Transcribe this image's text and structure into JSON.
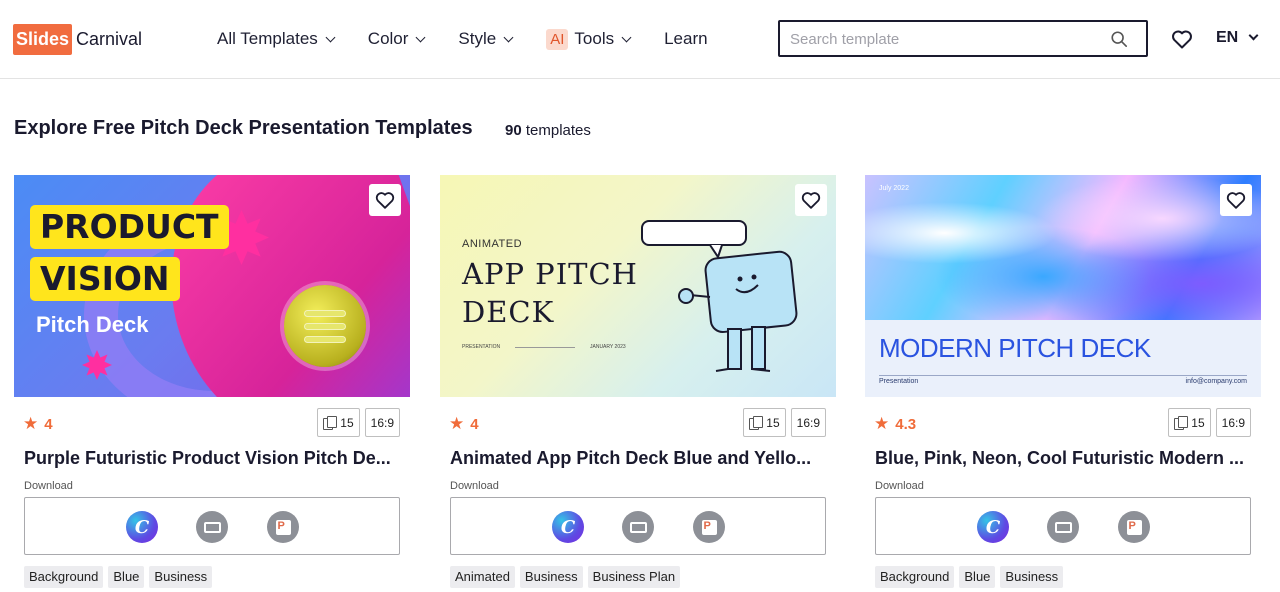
{
  "header": {
    "logo_box": "Slides",
    "logo_text": "Carnival",
    "nav": [
      {
        "label": "All Templates"
      },
      {
        "label": "Color"
      },
      {
        "label": "Style"
      },
      {
        "badge": "AI",
        "label": "Tools"
      },
      {
        "label": "Learn"
      }
    ],
    "search": {
      "placeholder": "Search template",
      "value": ""
    },
    "language": "EN"
  },
  "page": {
    "title": "Explore Free Pitch Deck Presentation Templates",
    "count_number": "90",
    "count_label": "templates"
  },
  "cards": [
    {
      "title": "Purple Futuristic Product Vision Pitch De...",
      "rating": "4",
      "slides": "15",
      "ratio": "16:9",
      "download_label": "Download",
      "tags": [
        "Background",
        "Blue",
        "Business"
      ],
      "thumb": {
        "line1": "PRODUCT",
        "line2": "VISION",
        "sub": "Pitch Deck"
      }
    },
    {
      "title": "Animated App Pitch Deck Blue and Yello...",
      "rating": "4",
      "slides": "15",
      "ratio": "16:9",
      "download_label": "Download",
      "tags": [
        "Animated",
        "Business",
        "Business Plan"
      ],
      "thumb": {
        "small": "ANIMATED",
        "line1": "APP PITCH",
        "line2": "DECK",
        "foot_left": "PRESENTATION",
        "foot_right": "JANUARY 2023"
      }
    },
    {
      "title": "Blue, Pink, Neon, Cool Futuristic Modern ...",
      "rating": "4.3",
      "slides": "15",
      "ratio": "16:9",
      "download_label": "Download",
      "tags": [
        "Background",
        "Blue",
        "Business"
      ],
      "thumb": {
        "date": "July 2022",
        "title": "MODERN PITCH DECK",
        "left": "Presentation",
        "right": "info@company.com"
      }
    }
  ],
  "colors": {
    "brand": "#f16c3f",
    "rating": "#f06c3a",
    "text": "#1a1a2e"
  }
}
